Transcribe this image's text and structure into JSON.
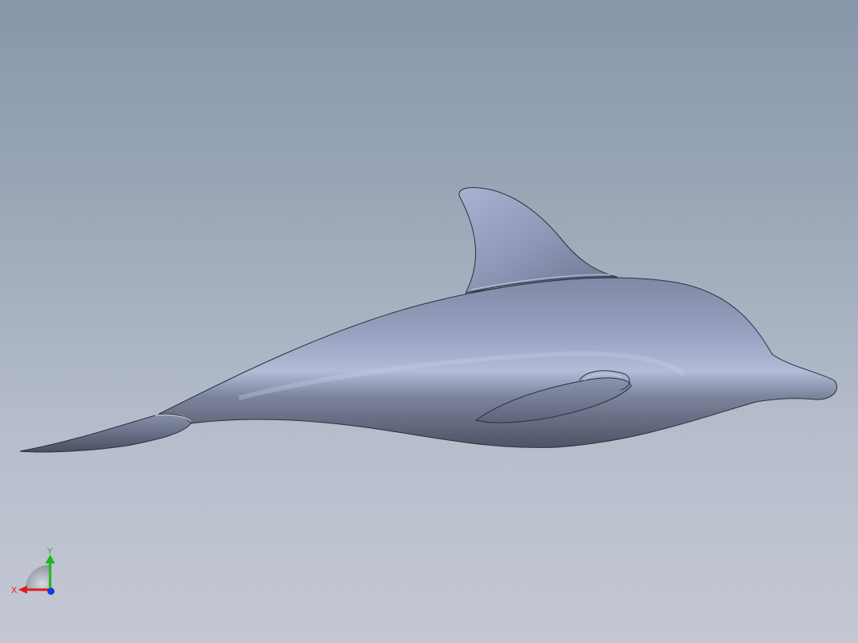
{
  "viewport": {
    "model": "dolphin",
    "background_top": "#8697aa",
    "background_bottom": "#c5c8d3",
    "model_color": "#8a93ae"
  },
  "triad": {
    "x_label": "X",
    "y_label": "Y",
    "x_color": "#e01a1a",
    "y_color": "#1fb51f",
    "z_color": "#1a3ad8"
  }
}
